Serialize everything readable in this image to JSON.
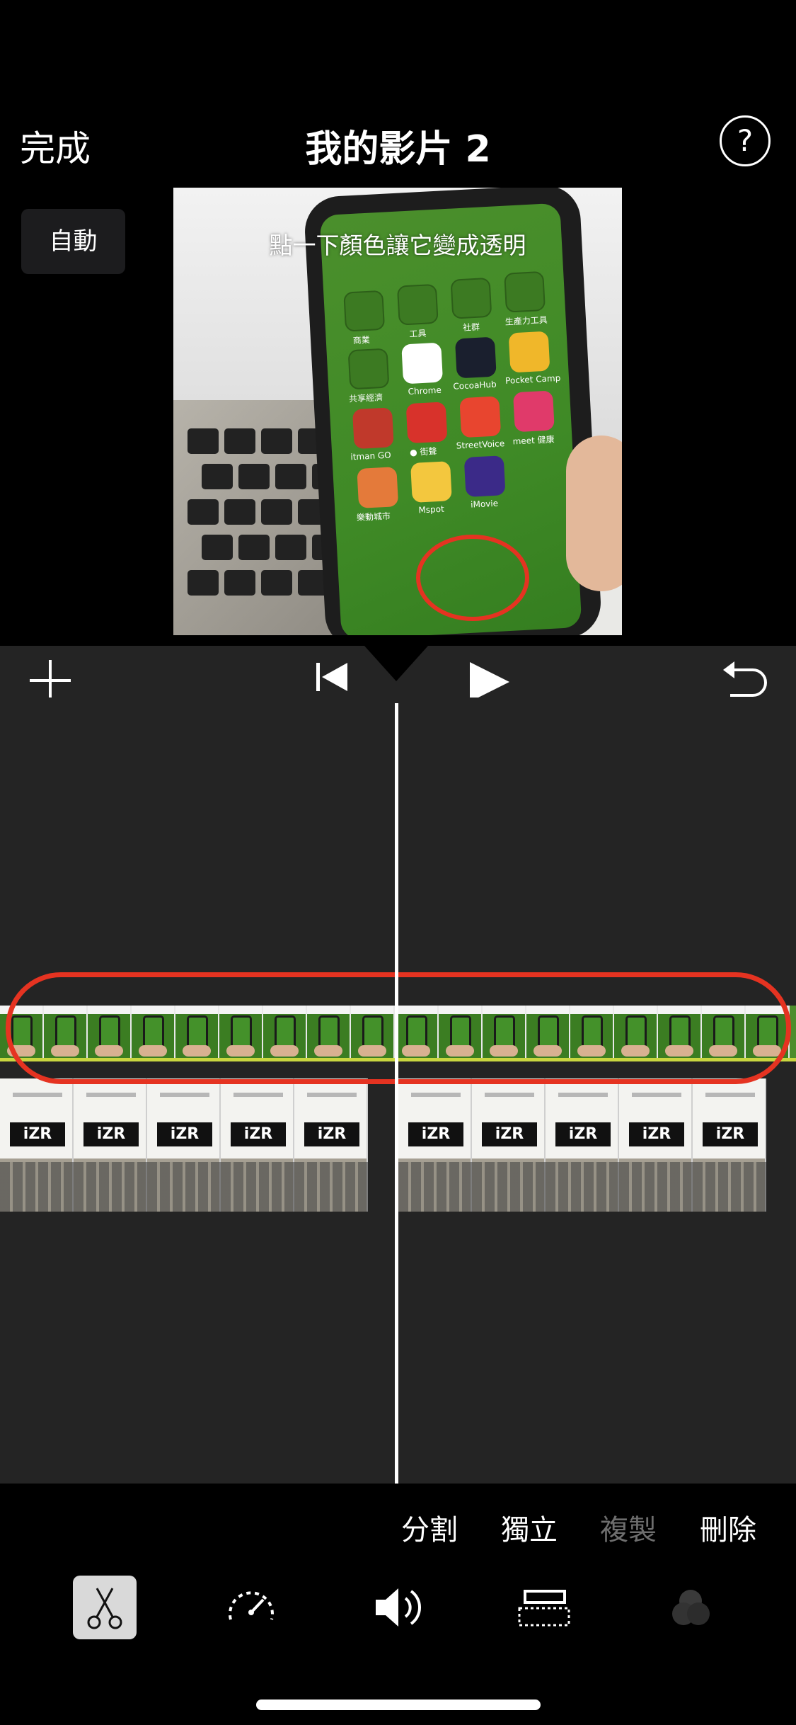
{
  "header": {
    "done_label": "完成",
    "title": "我的影片 2",
    "help_label": "?"
  },
  "preview": {
    "auto_label": "自動",
    "caption": "點一下顏色讓它變成透明",
    "app_labels": [
      "商業",
      "工具",
      "社群",
      "生產力工具",
      "共享經濟",
      "Chrome",
      "CocoaHub",
      "Pocket Camp",
      "itman GO",
      "● 街聲",
      "StreetVoice",
      "meet 健康",
      "樂動城市",
      "Mspot",
      "iMovie"
    ]
  },
  "actions": {
    "split": "分割",
    "detach": "獨立",
    "duplicate": "複製",
    "delete": "刪除"
  },
  "tools": [
    "scissors-icon",
    "speed-icon",
    "volume-icon",
    "titles-icon",
    "filters-icon"
  ],
  "colors": {
    "accent_red": "#e53321",
    "timeline_bg": "#242424",
    "green_screen": "#4d8d2c"
  }
}
